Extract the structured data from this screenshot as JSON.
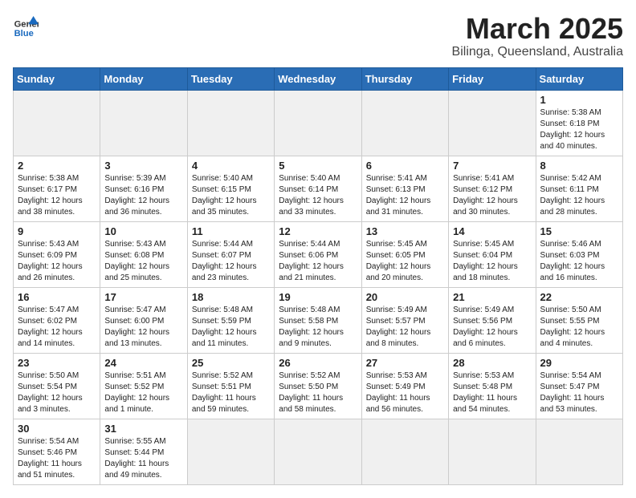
{
  "logo": {
    "text_general": "General",
    "text_blue": "Blue"
  },
  "header": {
    "month": "March 2025",
    "location": "Bilinga, Queensland, Australia"
  },
  "weekdays": [
    "Sunday",
    "Monday",
    "Tuesday",
    "Wednesday",
    "Thursday",
    "Friday",
    "Saturday"
  ],
  "days": [
    {
      "date": "",
      "info": ""
    },
    {
      "date": "",
      "info": ""
    },
    {
      "date": "",
      "info": ""
    },
    {
      "date": "",
      "info": ""
    },
    {
      "date": "",
      "info": ""
    },
    {
      "date": "",
      "info": ""
    },
    {
      "date": "1",
      "info": "Sunrise: 5:38 AM\nSunset: 6:18 PM\nDaylight: 12 hours\nand 40 minutes."
    },
    {
      "date": "2",
      "info": "Sunrise: 5:38 AM\nSunset: 6:17 PM\nDaylight: 12 hours\nand 38 minutes."
    },
    {
      "date": "3",
      "info": "Sunrise: 5:39 AM\nSunset: 6:16 PM\nDaylight: 12 hours\nand 36 minutes."
    },
    {
      "date": "4",
      "info": "Sunrise: 5:40 AM\nSunset: 6:15 PM\nDaylight: 12 hours\nand 35 minutes."
    },
    {
      "date": "5",
      "info": "Sunrise: 5:40 AM\nSunset: 6:14 PM\nDaylight: 12 hours\nand 33 minutes."
    },
    {
      "date": "6",
      "info": "Sunrise: 5:41 AM\nSunset: 6:13 PM\nDaylight: 12 hours\nand 31 minutes."
    },
    {
      "date": "7",
      "info": "Sunrise: 5:41 AM\nSunset: 6:12 PM\nDaylight: 12 hours\nand 30 minutes."
    },
    {
      "date": "8",
      "info": "Sunrise: 5:42 AM\nSunset: 6:11 PM\nDaylight: 12 hours\nand 28 minutes."
    },
    {
      "date": "9",
      "info": "Sunrise: 5:43 AM\nSunset: 6:09 PM\nDaylight: 12 hours\nand 26 minutes."
    },
    {
      "date": "10",
      "info": "Sunrise: 5:43 AM\nSunset: 6:08 PM\nDaylight: 12 hours\nand 25 minutes."
    },
    {
      "date": "11",
      "info": "Sunrise: 5:44 AM\nSunset: 6:07 PM\nDaylight: 12 hours\nand 23 minutes."
    },
    {
      "date": "12",
      "info": "Sunrise: 5:44 AM\nSunset: 6:06 PM\nDaylight: 12 hours\nand 21 minutes."
    },
    {
      "date": "13",
      "info": "Sunrise: 5:45 AM\nSunset: 6:05 PM\nDaylight: 12 hours\nand 20 minutes."
    },
    {
      "date": "14",
      "info": "Sunrise: 5:45 AM\nSunset: 6:04 PM\nDaylight: 12 hours\nand 18 minutes."
    },
    {
      "date": "15",
      "info": "Sunrise: 5:46 AM\nSunset: 6:03 PM\nDaylight: 12 hours\nand 16 minutes."
    },
    {
      "date": "16",
      "info": "Sunrise: 5:47 AM\nSunset: 6:02 PM\nDaylight: 12 hours\nand 14 minutes."
    },
    {
      "date": "17",
      "info": "Sunrise: 5:47 AM\nSunset: 6:00 PM\nDaylight: 12 hours\nand 13 minutes."
    },
    {
      "date": "18",
      "info": "Sunrise: 5:48 AM\nSunset: 5:59 PM\nDaylight: 12 hours\nand 11 minutes."
    },
    {
      "date": "19",
      "info": "Sunrise: 5:48 AM\nSunset: 5:58 PM\nDaylight: 12 hours\nand 9 minutes."
    },
    {
      "date": "20",
      "info": "Sunrise: 5:49 AM\nSunset: 5:57 PM\nDaylight: 12 hours\nand 8 minutes."
    },
    {
      "date": "21",
      "info": "Sunrise: 5:49 AM\nSunset: 5:56 PM\nDaylight: 12 hours\nand 6 minutes."
    },
    {
      "date": "22",
      "info": "Sunrise: 5:50 AM\nSunset: 5:55 PM\nDaylight: 12 hours\nand 4 minutes."
    },
    {
      "date": "23",
      "info": "Sunrise: 5:50 AM\nSunset: 5:54 PM\nDaylight: 12 hours\nand 3 minutes."
    },
    {
      "date": "24",
      "info": "Sunrise: 5:51 AM\nSunset: 5:52 PM\nDaylight: 12 hours\nand 1 minute."
    },
    {
      "date": "25",
      "info": "Sunrise: 5:52 AM\nSunset: 5:51 PM\nDaylight: 11 hours\nand 59 minutes."
    },
    {
      "date": "26",
      "info": "Sunrise: 5:52 AM\nSunset: 5:50 PM\nDaylight: 11 hours\nand 58 minutes."
    },
    {
      "date": "27",
      "info": "Sunrise: 5:53 AM\nSunset: 5:49 PM\nDaylight: 11 hours\nand 56 minutes."
    },
    {
      "date": "28",
      "info": "Sunrise: 5:53 AM\nSunset: 5:48 PM\nDaylight: 11 hours\nand 54 minutes."
    },
    {
      "date": "29",
      "info": "Sunrise: 5:54 AM\nSunset: 5:47 PM\nDaylight: 11 hours\nand 53 minutes."
    },
    {
      "date": "30",
      "info": "Sunrise: 5:54 AM\nSunset: 5:46 PM\nDaylight: 11 hours\nand 51 minutes."
    },
    {
      "date": "31",
      "info": "Sunrise: 5:55 AM\nSunset: 5:44 PM\nDaylight: 11 hours\nand 49 minutes."
    },
    {
      "date": "",
      "info": ""
    },
    {
      "date": "",
      "info": ""
    },
    {
      "date": "",
      "info": ""
    },
    {
      "date": "",
      "info": ""
    },
    {
      "date": "",
      "info": ""
    }
  ]
}
